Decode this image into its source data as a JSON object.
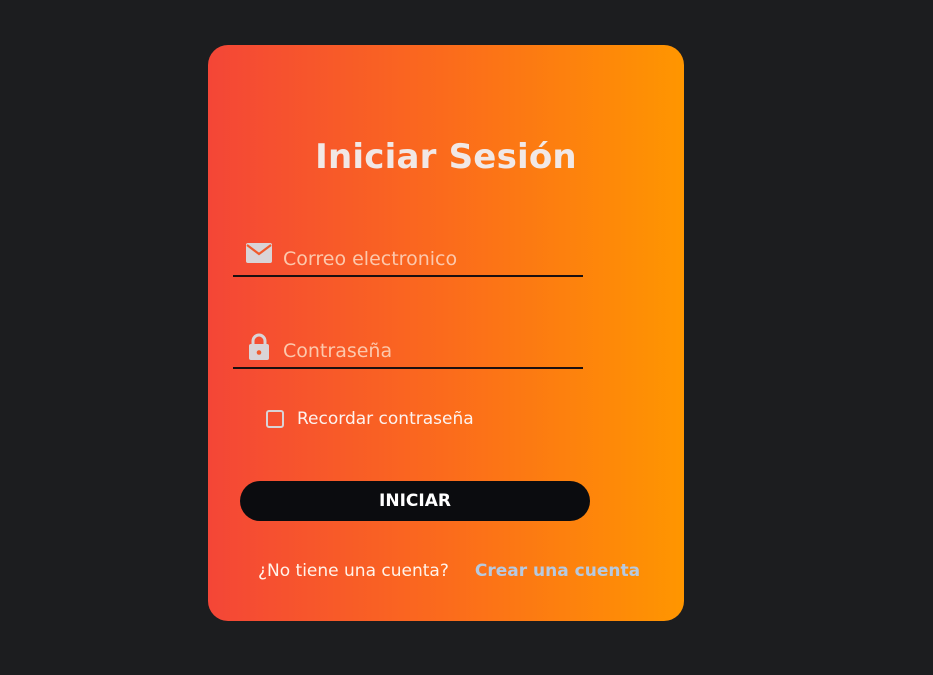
{
  "login": {
    "title": "Iniciar Sesión",
    "email": {
      "icon": "mail-icon",
      "placeholder": "Correo electronico",
      "value": ""
    },
    "password": {
      "icon": "lock-icon",
      "placeholder": "Contraseña",
      "value": ""
    },
    "remember": {
      "label": "Recordar contraseña",
      "checked": false
    },
    "submit_label": "INICIAR",
    "signup_prompt": "¿No tiene una cuenta?",
    "signup_link": "Crear una cuenta"
  },
  "colors": {
    "background": "#1c1d1f",
    "gradient_start": "#f44637",
    "gradient_end": "#ff9600",
    "button": "#0b0c0f",
    "link": "#b6c9e0"
  }
}
